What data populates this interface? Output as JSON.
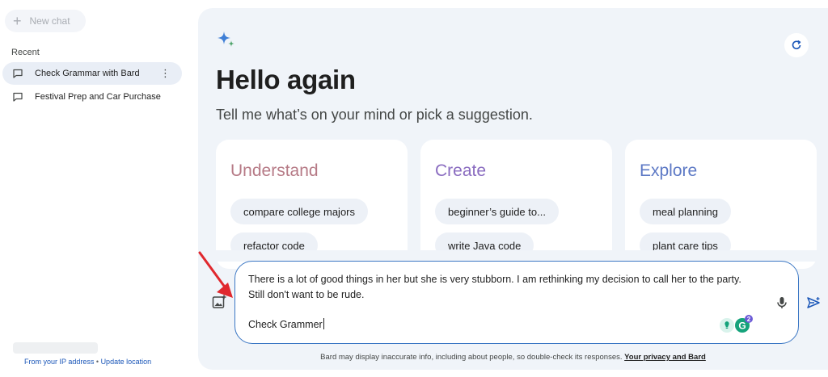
{
  "sidebar": {
    "new_chat_label": "New chat",
    "recent_label": "Recent",
    "chats": [
      {
        "label": "Check Grammar with Bard",
        "active": true
      },
      {
        "label": "Festival Prep and Car Purchase",
        "active": false
      }
    ],
    "more_icon": "⋮",
    "location": {
      "ip_text": "From your IP address",
      "separator": "•",
      "update_text": "Update location"
    }
  },
  "main": {
    "greeting": "Hello again",
    "subtitle": "Tell me what’s on your mind or pick a suggestion.",
    "cards": [
      {
        "title": "Understand",
        "chips": [
          "compare college majors",
          "refactor code"
        ]
      },
      {
        "title": "Create",
        "chips": [
          "beginner’s guide to...",
          "write Java code"
        ]
      },
      {
        "title": "Explore",
        "chips": [
          "meal planning",
          "plant care tips"
        ]
      }
    ]
  },
  "prompt": {
    "line1": "There is a lot of good things in her but she is very stubborn. I am rethinking my decision to call her to the party. Still don't want to be rude.",
    "line2": "Check Grammer",
    "grammarly_count": "2"
  },
  "footer": {
    "disclaimer": "Bard may display inaccurate info, including about people, so double-check its responses.",
    "privacy_link": "Your privacy and Bard"
  },
  "colors": {
    "accent": "#3b77c4",
    "main_bg": "#f0f4f9",
    "understand": "#b67a86",
    "create": "#8a6cc0",
    "explore": "#5d79c5",
    "annotation_arrow": "#e0282e"
  },
  "icons": [
    "plus-icon",
    "chat-bubble-icon",
    "more-vert-icon",
    "sparkle-icon",
    "refresh-icon",
    "add-image-icon",
    "mic-icon",
    "grammarly-icon",
    "send-icon"
  ]
}
